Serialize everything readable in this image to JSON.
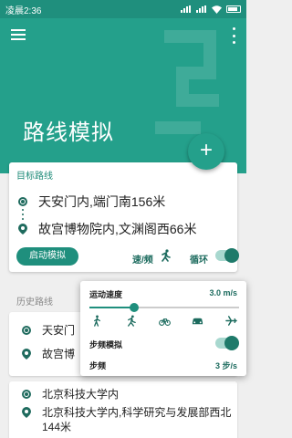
{
  "statusbar": {
    "time": "凌晨2:36"
  },
  "app": {
    "title": "路线模拟",
    "fab_label": "+"
  },
  "target": {
    "label": "目标路线",
    "start": "天安门内,端门南156米",
    "end": "故宫博物院内,文渊阁西66米",
    "start_button": "启动模拟",
    "speed_label": "速/频",
    "loop_label": "循环",
    "loop_on": true
  },
  "history": {
    "label": "历史路线",
    "items": [
      {
        "start": "天安门",
        "end": "故宫博"
      },
      {
        "start": "北京科技大学内",
        "end": "北京科技大学内,科学研究与发展部西北144米"
      }
    ]
  },
  "speed_popup": {
    "speed_label": "运动速度",
    "speed_value": "3.0  m/s",
    "slider_fraction": 0.3,
    "modes": [
      "walk-icon",
      "run-icon",
      "bike-icon",
      "car-icon",
      "plane-icon"
    ],
    "step_mode_label": "步频模拟",
    "step_mode_on": true,
    "step_label": "步频",
    "step_value": "3  步/s"
  },
  "colors": {
    "primary": "#24a08b",
    "dark": "#1f8f7d"
  }
}
